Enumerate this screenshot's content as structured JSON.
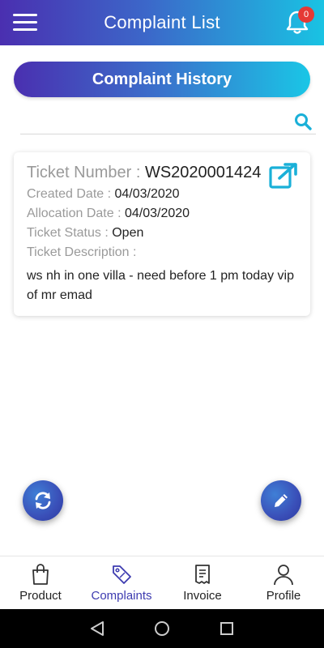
{
  "header": {
    "title": "Complaint List",
    "notification_count": "0"
  },
  "history_button_label": "Complaint History",
  "search": {
    "icon": "search-icon"
  },
  "ticket": {
    "number_label": "Ticket Number : ",
    "number": "WS2020001424",
    "created_label": "Created Date : ",
    "created": "04/03/2020",
    "allocation_label": "Allocation Date : ",
    "allocation": "04/03/2020",
    "status_label": "Ticket Status : ",
    "status": "Open",
    "description_label": "Ticket Description :",
    "description": "ws nh in one villa - need before 1 pm today vip of mr emad"
  },
  "bottom_nav": [
    {
      "label": "Product",
      "icon": "bag-icon",
      "active": false
    },
    {
      "label": "Complaints",
      "icon": "tag-icon",
      "active": true
    },
    {
      "label": "Invoice",
      "icon": "receipt-icon",
      "active": false
    },
    {
      "label": "Profile",
      "icon": "person-icon",
      "active": false
    }
  ],
  "colors": {
    "gradient_start": "#4a2fb0",
    "gradient_end": "#19c3e3",
    "accent_icon": "#1ab0d8",
    "active_nav": "#3d3bb0",
    "badge": "#e53935"
  }
}
